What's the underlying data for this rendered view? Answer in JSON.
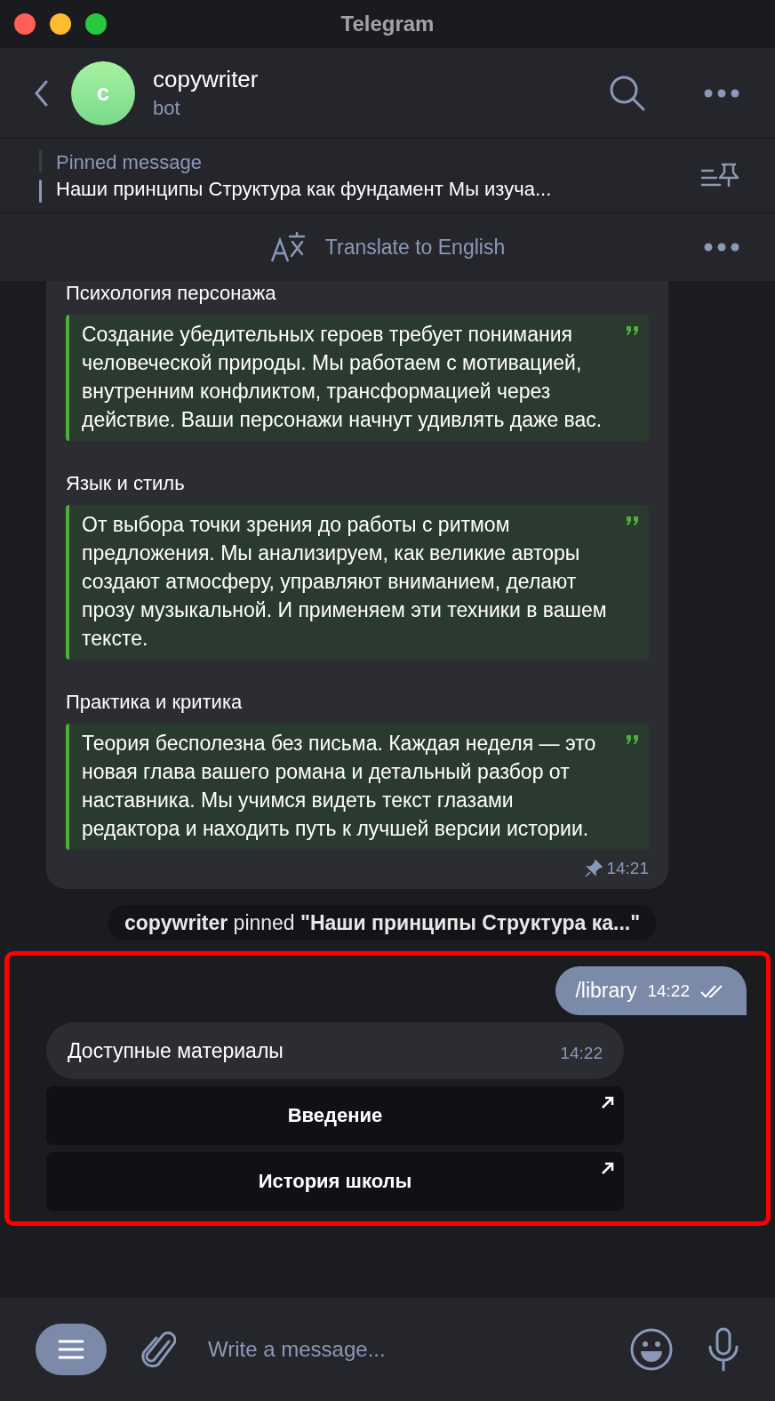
{
  "window": {
    "title": "Telegram"
  },
  "chat": {
    "name": "copywriter",
    "status": "bot",
    "avatar_letter": "c"
  },
  "pinned": {
    "label": "Pinned message",
    "text": "Наши принципы  Структура как фундамент Мы изуча..."
  },
  "translate": {
    "label": "Translate to English"
  },
  "message": {
    "sections": [
      {
        "heading": "Психология персонажа",
        "quote": "Создание убедительных героев требует понимания человеческой природы. Мы работаем с мотивацией, внутренним конфликтом, трансформацией через действие. Ваши персонажи начнут удивлять даже вас."
      },
      {
        "heading": "Язык и стиль",
        "quote": "От выбора точки зрения до работы с ритмом предложения. Мы анализируем, как великие авторы создают атмосферу, управляют вниманием, делают прозу музыкальной. И применяем эти техники в вашем тексте."
      },
      {
        "heading": "Практика и критика",
        "quote": "Теория бесполезна без письма. Каждая неделя — это новая глава вашего романа и детальный разбор от наставника. Мы учимся видеть текст глазами редактора и находить путь к лучшей версии истории."
      }
    ],
    "time": "14:21",
    "pinned": true
  },
  "service": {
    "text": "**copywriter** pinned **\"Наши принципы  Структура ка...\"**"
  },
  "highlighted": true,
  "outgoing": {
    "text": "/library",
    "time": "14:22",
    "read": true
  },
  "incoming": {
    "text": "Доступные материалы",
    "time": "14:22"
  },
  "buttons": [
    {
      "label": "Введение"
    },
    {
      "label": "История школы"
    }
  ],
  "composer": {
    "placeholder": "Write a message..."
  }
}
